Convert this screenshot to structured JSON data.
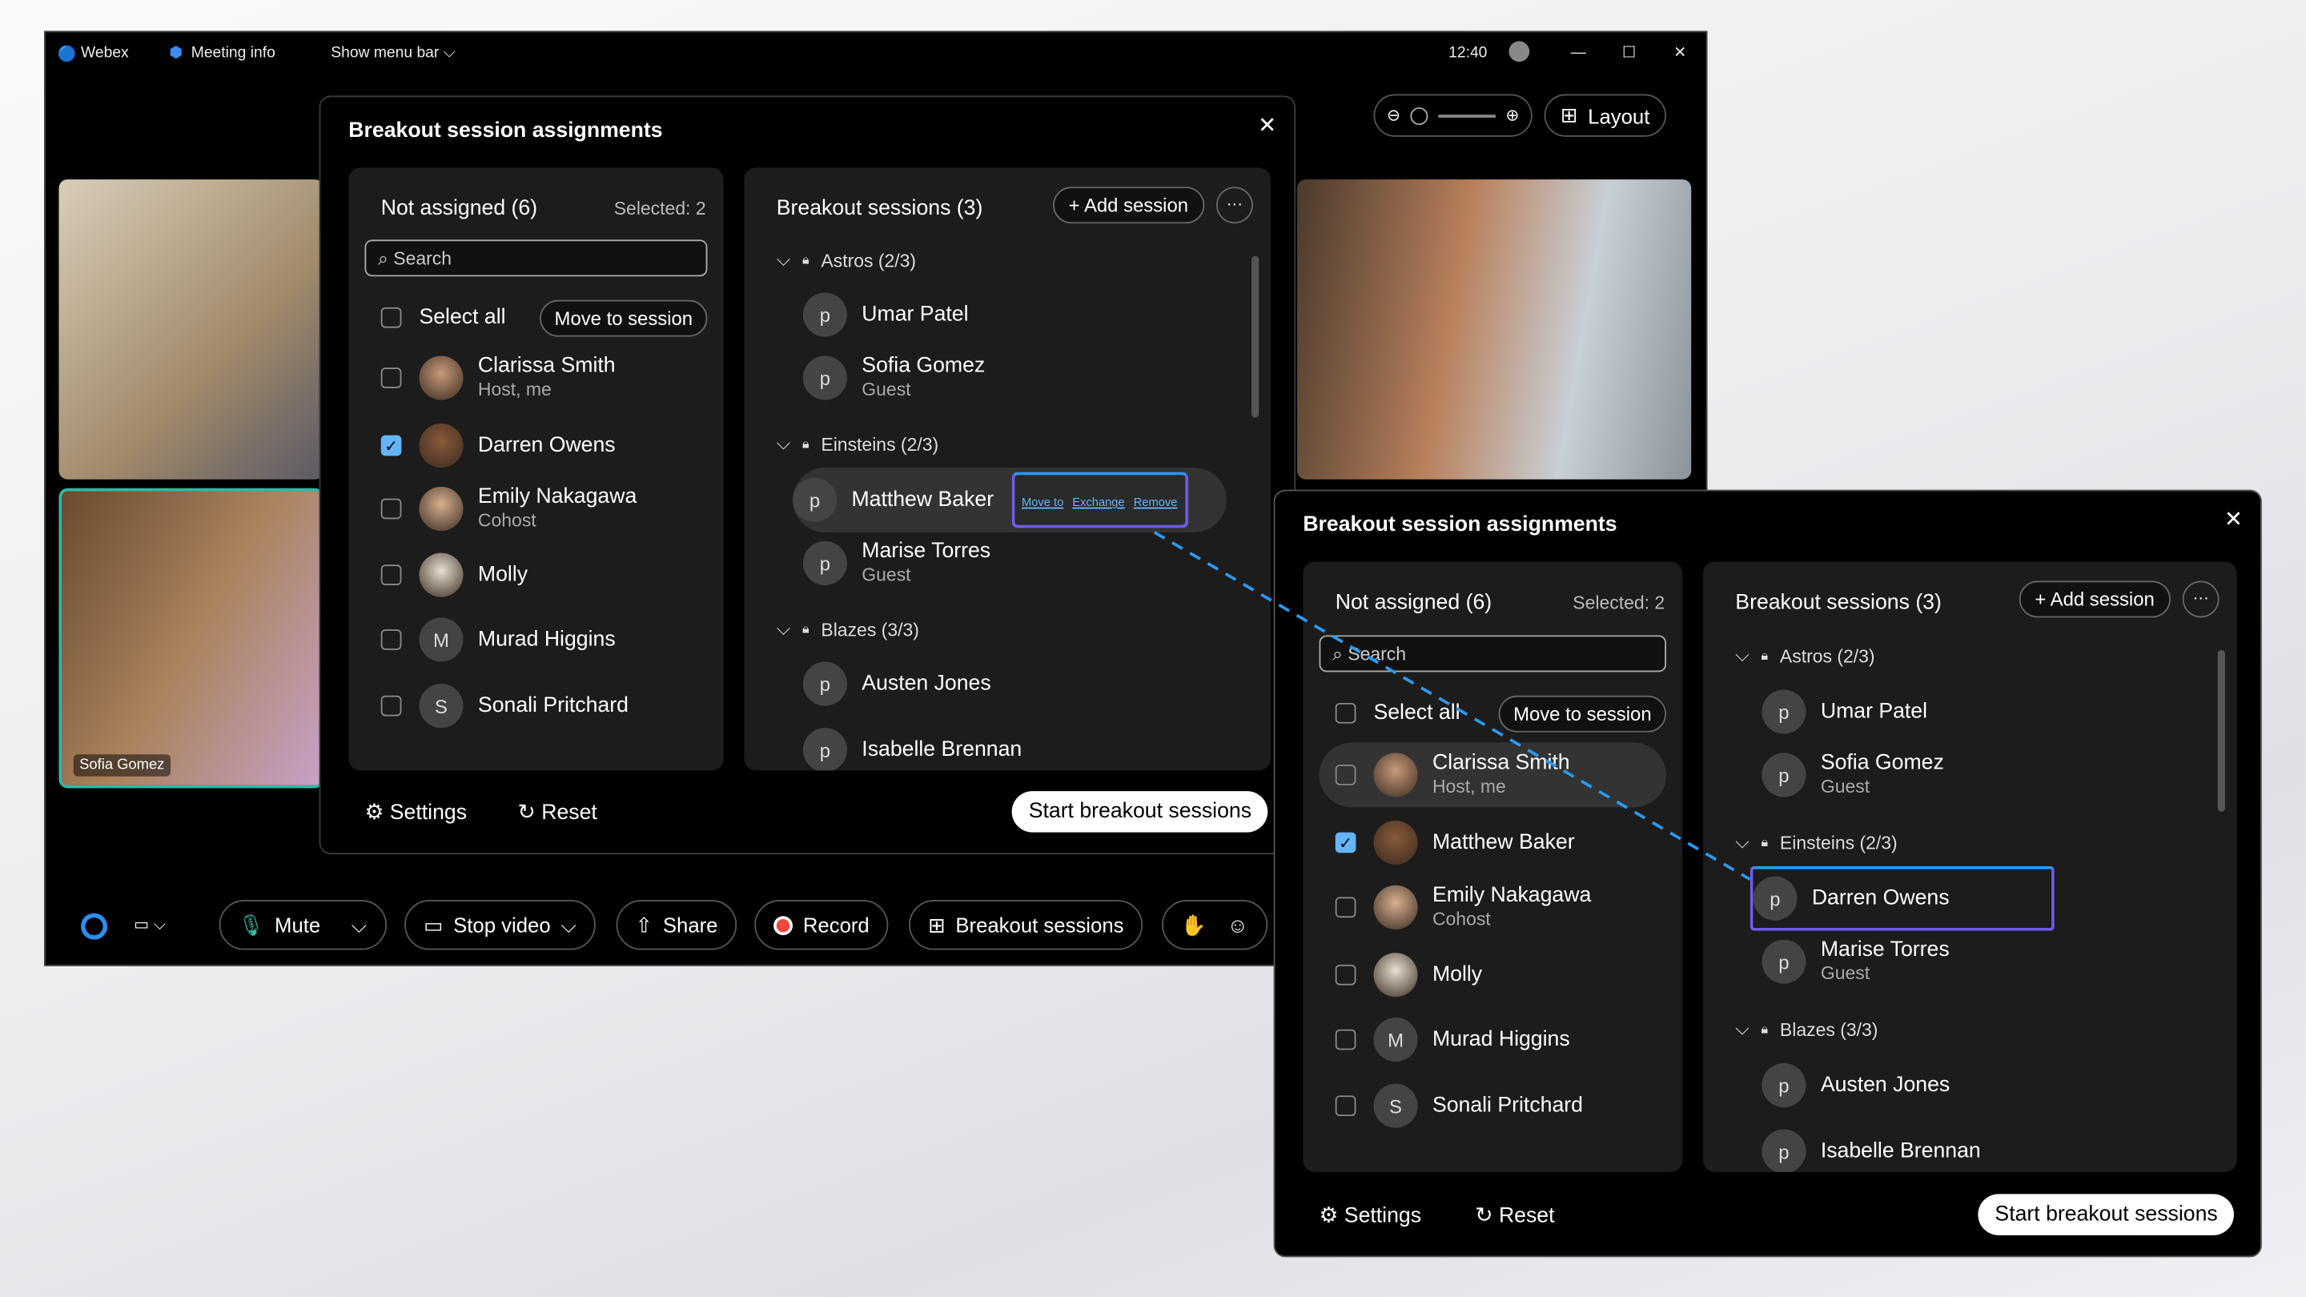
{
  "titlebar": {
    "app": "Webex",
    "meeting_info": "Meeting info",
    "show_menu": "Show menu bar",
    "time": "12:40"
  },
  "toolbar": {
    "layout": "Layout",
    "mute": "Mute",
    "stop_video": "Stop video",
    "share": "Share",
    "record": "Record",
    "breakout": "Breakout sessions"
  },
  "video": {
    "tile_name": "Sofia Gomez"
  },
  "colors": {
    "accent": "#64b4fa",
    "highlight": "#7b5cf0",
    "record": "#f0483e"
  },
  "dialog1": {
    "title": "Breakout session assignments",
    "not_assigned": "Not assigned (6)",
    "selected": "Selected: 2",
    "search_placeholder": "Search",
    "select_all": "Select all",
    "move_to_session": "Move to session",
    "participants": [
      {
        "name": "Clarissa Smith",
        "sub": "Host, me",
        "checked": false,
        "avatar": "photo"
      },
      {
        "name": "Darren Owens",
        "sub": "",
        "checked": true,
        "avatar": "photo"
      },
      {
        "name": "Emily Nakagawa",
        "sub": "Cohost",
        "checked": false,
        "avatar": "photo"
      },
      {
        "name": "Molly",
        "sub": "",
        "checked": false,
        "avatar": "dog"
      },
      {
        "name": "Murad Higgins",
        "sub": "",
        "checked": false,
        "avatar": "M"
      },
      {
        "name": "Sonali Pritchard",
        "sub": "",
        "checked": false,
        "avatar": "S"
      }
    ],
    "sessions_title": "Breakout sessions (3)",
    "add_session": "Add session",
    "sessions": [
      {
        "name": "Astros (2/3)",
        "members": [
          {
            "name": "Umar Patel",
            "sub": ""
          },
          {
            "name": "Sofia Gomez",
            "sub": "Guest"
          }
        ]
      },
      {
        "name": "Einsteins (2/3)",
        "members": [
          {
            "name": "Matthew Baker",
            "sub": "",
            "hover": true
          },
          {
            "name": "Marise Torres",
            "sub": "Guest"
          }
        ]
      },
      {
        "name": "Blazes (3/3)",
        "members": [
          {
            "name": "Austen Jones",
            "sub": ""
          },
          {
            "name": "Isabelle Brennan",
            "sub": ""
          }
        ]
      }
    ],
    "hover_actions": [
      "Move to",
      "Exchange",
      "Remove"
    ],
    "settings": "Settings",
    "reset": "Reset",
    "start": "Start breakout sessions"
  },
  "dialog2": {
    "title": "Breakout session assignments",
    "not_assigned": "Not assigned (6)",
    "selected": "Selected: 2",
    "search_placeholder": "Search",
    "select_all": "Select all",
    "move_to_session": "Move to session",
    "participants": [
      {
        "name": "Clarissa Smith",
        "sub": "Host, me",
        "checked": false,
        "avatar": "photo",
        "hover": true
      },
      {
        "name": "Matthew Baker",
        "sub": "",
        "checked": true,
        "avatar": "photo"
      },
      {
        "name": "Emily Nakagawa",
        "sub": "Cohost",
        "checked": false,
        "avatar": "photo"
      },
      {
        "name": "Molly",
        "sub": "",
        "checked": false,
        "avatar": "dog"
      },
      {
        "name": "Murad Higgins",
        "sub": "",
        "checked": false,
        "avatar": "M"
      },
      {
        "name": "Sonali Pritchard",
        "sub": "",
        "checked": false,
        "avatar": "S"
      }
    ],
    "sessions_title": "Breakout sessions (3)",
    "add_session": "Add session",
    "sessions": [
      {
        "name": "Astros (2/3)",
        "members": [
          {
            "name": "Umar Patel",
            "sub": ""
          },
          {
            "name": "Sofia Gomez",
            "sub": "Guest"
          }
        ]
      },
      {
        "name": "Einsteins (2/3)",
        "members": [
          {
            "name": "Darren Owens",
            "sub": "",
            "dropped": true
          },
          {
            "name": "Marise Torres",
            "sub": "Guest"
          }
        ]
      },
      {
        "name": "Blazes (3/3)",
        "members": [
          {
            "name": "Austen Jones",
            "sub": ""
          },
          {
            "name": "Isabelle Brennan",
            "sub": ""
          }
        ]
      }
    ],
    "settings": "Settings",
    "reset": "Reset",
    "start": "Start breakout sessions"
  }
}
